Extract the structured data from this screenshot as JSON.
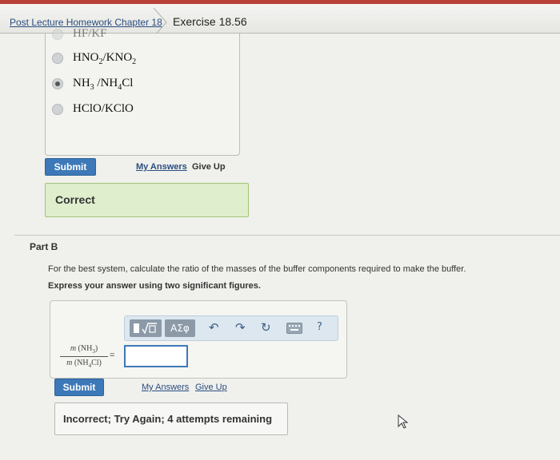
{
  "header": {
    "breadcrumb_link": "Post Lecture Homework Chapter 18",
    "current_item": "Exercise 18.56"
  },
  "part_a": {
    "choices": [
      {
        "formula_html": "HF/KF",
        "selected": false
      },
      {
        "formula_html": "HNO<sub>2</sub>/KNO<sub>2</sub>",
        "selected": false
      },
      {
        "formula_html": "NH<sub>3</sub> /NH<sub>4</sub>Cl",
        "selected": true
      },
      {
        "formula_html": "HClO/KClO",
        "selected": false
      }
    ],
    "submit_label": "Submit",
    "my_answers_label": "My Answers",
    "give_up_label": "Give Up",
    "feedback": "Correct"
  },
  "part_b": {
    "title": "Part B",
    "question": "For the best system, calculate the ratio of the masses of the buffer components required to make the buffer.",
    "instruction": "Express your answer using two significant figures.",
    "toolbar": {
      "templates_icon": "templates-icon",
      "symbols_label": "ΑΣφ",
      "undo_icon": "undo-icon",
      "redo_icon": "redo-icon",
      "reset_icon": "reset-icon",
      "keyboard_icon": "keyboard-icon",
      "help_label": "?"
    },
    "fraction_numerator_html": "<i>m</i> (NH<sub>3</sub>)",
    "fraction_denominator_html": "<i>m</i> (NH<sub>4</sub>Cl)",
    "equals": "=",
    "answer_value": "",
    "submit_label": "Submit",
    "my_answers_label": "My Answers",
    "give_up_label": "Give Up",
    "feedback": "Incorrect; Try Again; 4 attempts remaining"
  },
  "colors": {
    "accent_blue": "#3d79b8",
    "correct_bg": "#dfeecd",
    "top_strip": "#b8413a"
  }
}
